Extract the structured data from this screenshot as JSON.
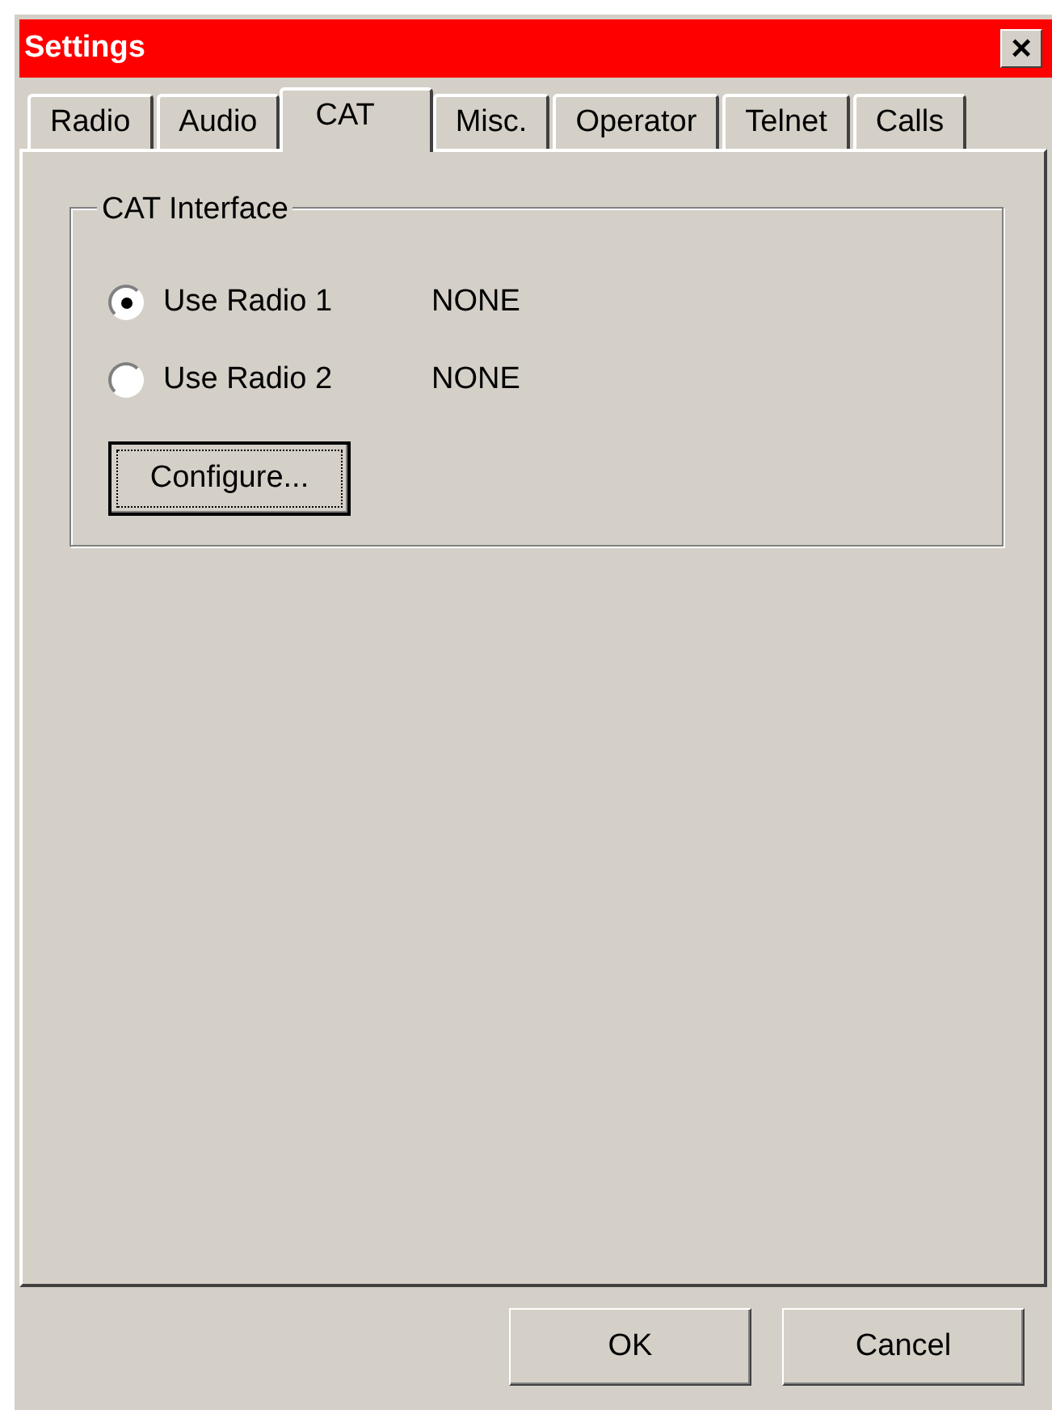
{
  "window": {
    "title": "Settings",
    "close": "×"
  },
  "tabs": [
    {
      "label": "Radio",
      "selected": false
    },
    {
      "label": "Audio",
      "selected": false
    },
    {
      "label": "CAT",
      "selected": true
    },
    {
      "label": "Misc.",
      "selected": false
    },
    {
      "label": "Operator",
      "selected": false
    },
    {
      "label": "Telnet",
      "selected": false
    },
    {
      "label": "Calls",
      "selected": false
    }
  ],
  "group": {
    "title": "CAT Interface",
    "options": [
      {
        "label": "Use Radio 1",
        "value": "NONE",
        "selected": true
      },
      {
        "label": "Use Radio 2",
        "value": "NONE",
        "selected": false
      }
    ],
    "button": "Configure..."
  },
  "buttons": [
    "OK",
    "Cancel"
  ]
}
